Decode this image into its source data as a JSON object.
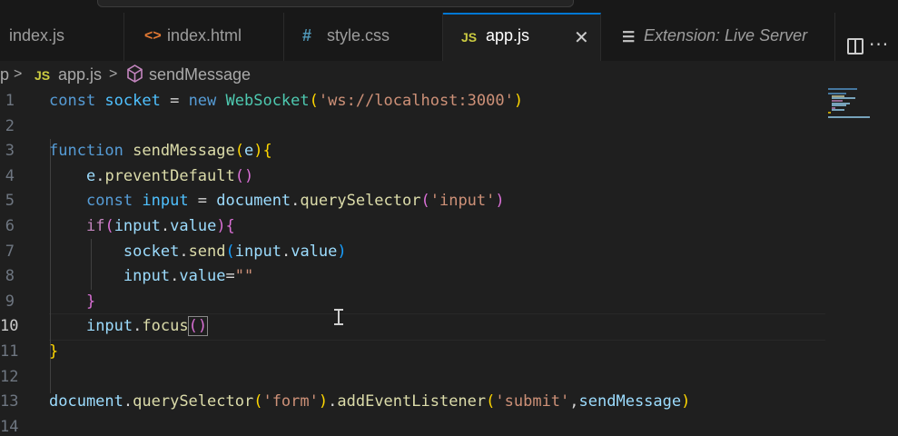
{
  "tabs": [
    {
      "name": "index-js-tab",
      "label": "index.js"
    },
    {
      "name": "index-html-tab",
      "label": "index.html",
      "icon": "<>"
    },
    {
      "name": "style-css-tab",
      "label": "style.css",
      "icon": "#"
    },
    {
      "name": "app-js-tab",
      "label": "app.js",
      "icon": "JS",
      "active": true
    },
    {
      "name": "live-server-tab",
      "label": "Extension: Live Server"
    }
  ],
  "breadcrumb": {
    "root": "p",
    "file_icon": "JS",
    "file": "app.js",
    "symbol": "sendMessage"
  },
  "editor": {
    "line_numbers": [
      "1",
      "2",
      "3",
      "4",
      "5",
      "6",
      "7",
      "8",
      "9",
      "10",
      "11",
      "12",
      "13",
      "14"
    ],
    "current_line": "10",
    "code": [
      [
        [
          "kw",
          "const "
        ],
        [
          "cn",
          "socket"
        ],
        [
          "op",
          " = "
        ],
        [
          "kw",
          "new "
        ],
        [
          "ty",
          "WebSocket"
        ],
        [
          "p1",
          "("
        ],
        [
          "st",
          "'ws://localhost:3000'"
        ],
        [
          "p1",
          ")"
        ]
      ],
      [],
      [
        [
          "kw",
          "function "
        ],
        [
          "fn",
          "sendMessage"
        ],
        [
          "p1",
          "("
        ],
        [
          "vr",
          "e"
        ],
        [
          "p1",
          "){"
        ]
      ],
      [
        [
          "op",
          "    "
        ],
        [
          "vr",
          "e"
        ],
        [
          "op",
          "."
        ],
        [
          "fn",
          "preventDefault"
        ],
        [
          "p2",
          "()"
        ]
      ],
      [
        [
          "op",
          "    "
        ],
        [
          "kw",
          "const "
        ],
        [
          "cn",
          "input"
        ],
        [
          "op",
          " = "
        ],
        [
          "vr",
          "document"
        ],
        [
          "op",
          "."
        ],
        [
          "fn",
          "querySelector"
        ],
        [
          "p2",
          "("
        ],
        [
          "st",
          "'input'"
        ],
        [
          "p2",
          ")"
        ]
      ],
      [
        [
          "op",
          "    "
        ],
        [
          "ct",
          "if"
        ],
        [
          "p2",
          "("
        ],
        [
          "vr",
          "input"
        ],
        [
          "op",
          "."
        ],
        [
          "vr",
          "value"
        ],
        [
          "p2",
          "){"
        ]
      ],
      [
        [
          "op",
          "        "
        ],
        [
          "vr",
          "socket"
        ],
        [
          "op",
          "."
        ],
        [
          "fn",
          "send"
        ],
        [
          "p3",
          "("
        ],
        [
          "vr",
          "input"
        ],
        [
          "op",
          "."
        ],
        [
          "vr",
          "value"
        ],
        [
          "p3",
          ")"
        ]
      ],
      [
        [
          "op",
          "        "
        ],
        [
          "vr",
          "input"
        ],
        [
          "op",
          "."
        ],
        [
          "vr",
          "value"
        ],
        [
          "op",
          "="
        ],
        [
          "st",
          "\"\""
        ]
      ],
      [
        [
          "op",
          "    "
        ],
        [
          "p2",
          "}"
        ]
      ],
      [
        [
          "op",
          "    "
        ],
        [
          "vr",
          "input"
        ],
        [
          "op",
          "."
        ],
        [
          "fn",
          "focus"
        ],
        [
          "hl",
          "()"
        ]
      ],
      [
        [
          "p1",
          "}"
        ]
      ],
      [],
      [
        [
          "vr",
          "document"
        ],
        [
          "op",
          "."
        ],
        [
          "fn",
          "querySelector"
        ],
        [
          "p1",
          "("
        ],
        [
          "st",
          "'form'"
        ],
        [
          "p1",
          ")"
        ],
        [
          "op",
          "."
        ],
        [
          "fn",
          "addEventListener"
        ],
        [
          "p1",
          "("
        ],
        [
          "st",
          "'submit'"
        ],
        [
          "op",
          ","
        ],
        [
          "vr",
          "sendMessage"
        ],
        [
          "p1",
          ")"
        ]
      ],
      []
    ]
  }
}
